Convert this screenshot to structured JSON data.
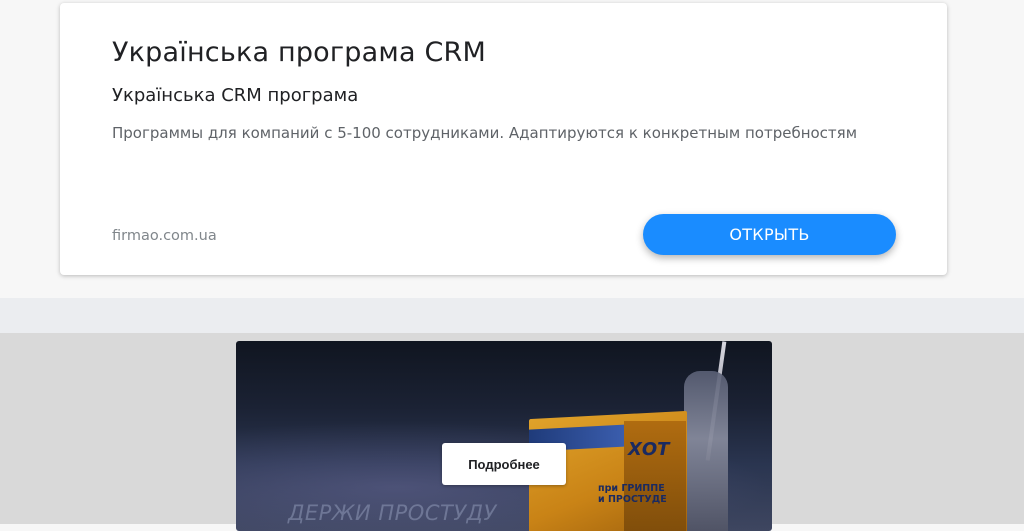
{
  "ad": {
    "title": "Українська програма CRM",
    "subtitle": "Українська CRM програма",
    "description": "Программы для компаний с 5-100 сотрудниками. Адаптируются к конкретным потребностям",
    "domain": "firmao.com.ua",
    "open_label": "ОТКРЫТЬ",
    "button_color": "#1a8cff"
  },
  "video_ad": {
    "details_label": "Подробнее",
    "tagline": "ДЕРЖИ ПРОСТУДУ",
    "product_brand": "ХОТ",
    "product_caption": "при ГРИППЕ и ПРОСТУДЕ"
  }
}
